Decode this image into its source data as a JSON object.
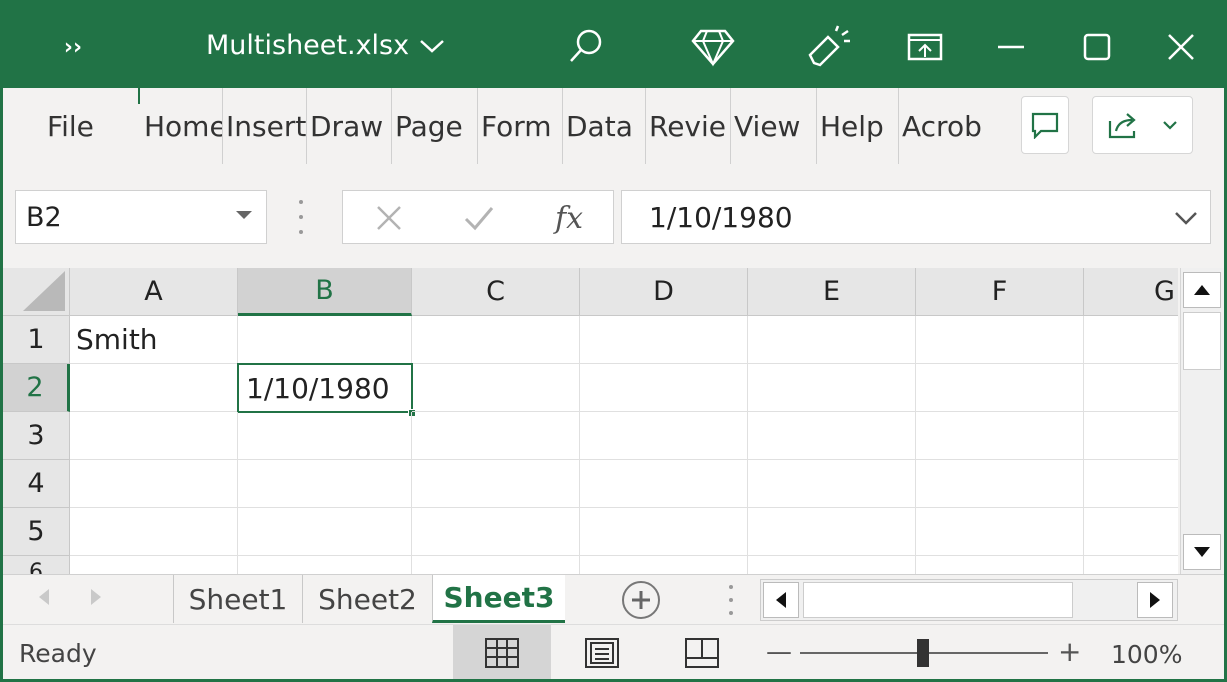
{
  "app": {
    "title": "Multisheet.xlsx",
    "accent": "#217346"
  },
  "titlebar": {
    "more_icon": "chevron-double-right-icon",
    "search_icon": "search-icon",
    "premium_icon": "diamond-icon",
    "ideas_icon": "lightbulb-icon"
  },
  "ribbon": {
    "tabs": [
      "File",
      "Home",
      "Insert",
      "Draw",
      "Page",
      "Form",
      "Data",
      "Revie",
      "View",
      "Help",
      "Acrob"
    ]
  },
  "formula_bar": {
    "name_box": "B2",
    "value": "1/10/1980",
    "fx_label": "fx"
  },
  "grid": {
    "columns": [
      "A",
      "B",
      "C",
      "D",
      "E",
      "F",
      "G"
    ],
    "rows": [
      "1",
      "2",
      "3",
      "4",
      "5",
      "6"
    ],
    "cells": {
      "A1": "Smith",
      "B2": "1/10/1980"
    },
    "active_cell": "B2"
  },
  "sheets": {
    "tabs": [
      "Sheet1",
      "Sheet2",
      "Sheet3"
    ],
    "active": "Sheet3"
  },
  "status": {
    "text": "Ready",
    "zoom": "100%",
    "zoom_percent": 100
  }
}
